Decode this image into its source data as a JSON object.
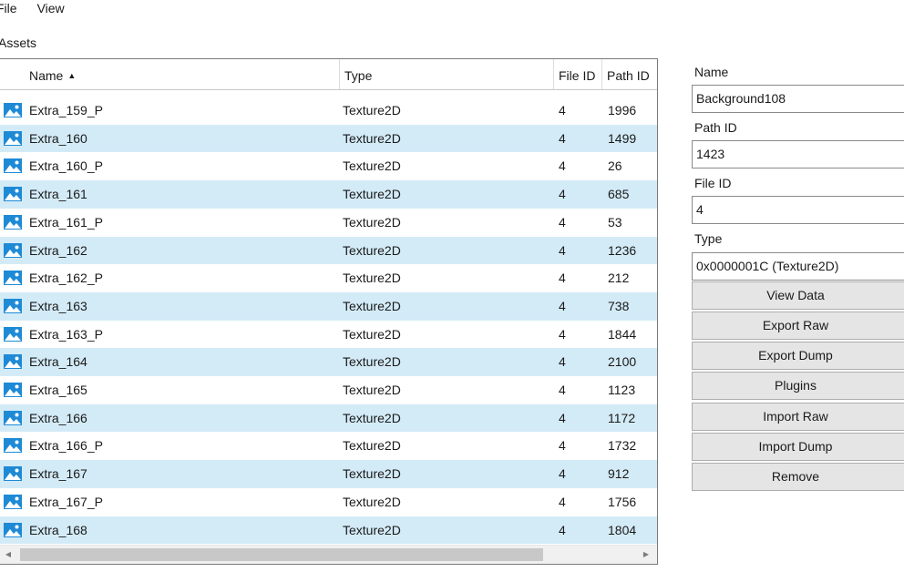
{
  "menu": [
    "File",
    "View"
  ],
  "assets_label": "Assets",
  "columns": {
    "name": "Name",
    "type": "Type",
    "file_id": "File ID",
    "path_id": "Path ID"
  },
  "rows": [
    {
      "name": "Extra_159_P",
      "type": "Texture2D",
      "file_id": "4",
      "path_id": "1996"
    },
    {
      "name": "Extra_160",
      "type": "Texture2D",
      "file_id": "4",
      "path_id": "1499"
    },
    {
      "name": "Extra_160_P",
      "type": "Texture2D",
      "file_id": "4",
      "path_id": "26"
    },
    {
      "name": "Extra_161",
      "type": "Texture2D",
      "file_id": "4",
      "path_id": "685"
    },
    {
      "name": "Extra_161_P",
      "type": "Texture2D",
      "file_id": "4",
      "path_id": "53"
    },
    {
      "name": "Extra_162",
      "type": "Texture2D",
      "file_id": "4",
      "path_id": "1236"
    },
    {
      "name": "Extra_162_P",
      "type": "Texture2D",
      "file_id": "4",
      "path_id": "212"
    },
    {
      "name": "Extra_163",
      "type": "Texture2D",
      "file_id": "4",
      "path_id": "738"
    },
    {
      "name": "Extra_163_P",
      "type": "Texture2D",
      "file_id": "4",
      "path_id": "1844"
    },
    {
      "name": "Extra_164",
      "type": "Texture2D",
      "file_id": "4",
      "path_id": "2100"
    },
    {
      "name": "Extra_165",
      "type": "Texture2D",
      "file_id": "4",
      "path_id": "1123"
    },
    {
      "name": "Extra_166",
      "type": "Texture2D",
      "file_id": "4",
      "path_id": "1172"
    },
    {
      "name": "Extra_166_P",
      "type": "Texture2D",
      "file_id": "4",
      "path_id": "1732"
    },
    {
      "name": "Extra_167",
      "type": "Texture2D",
      "file_id": "4",
      "path_id": "912"
    },
    {
      "name": "Extra_167_P",
      "type": "Texture2D",
      "file_id": "4",
      "path_id": "1756"
    },
    {
      "name": "Extra_168",
      "type": "Texture2D",
      "file_id": "4",
      "path_id": "1804"
    }
  ],
  "properties": {
    "name_label": "Name",
    "name_value": "Background108",
    "path_id_label": "Path ID",
    "path_id_value": "1423",
    "file_id_label": "File ID",
    "file_id_value": "4",
    "type_label": "Type",
    "type_value": "0x0000001C (Texture2D)"
  },
  "buttons": [
    "View Data",
    "Export Raw",
    "Export Dump",
    "Plugins",
    "Import Raw",
    "Import Dump",
    "Remove"
  ],
  "colors": {
    "row_alt": "#d3ebf7",
    "icon_blue": "#1e8ad6"
  },
  "icons": {
    "row_icon": "image-icon",
    "sort": "sort-ascending-icon"
  }
}
